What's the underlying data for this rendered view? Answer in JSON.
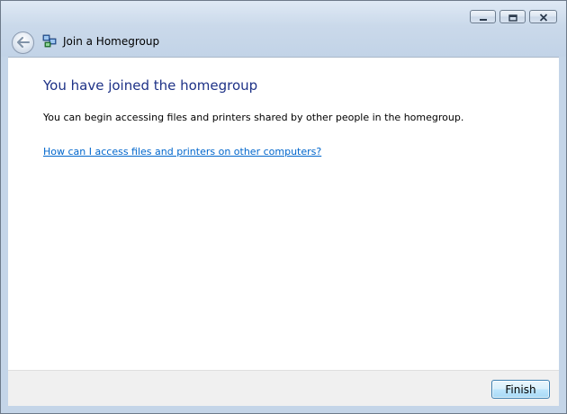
{
  "window": {
    "title": "Join a Homegroup",
    "caption_buttons": [
      "minimize",
      "maximize",
      "close"
    ]
  },
  "icons": {
    "back": "back-arrow-icon",
    "homegroup": "homegroup-icon",
    "minimize": "minimize-icon",
    "maximize": "maximize-icon",
    "close": "close-icon"
  },
  "main": {
    "heading": "You have joined the homegroup",
    "description": "You can begin accessing files and printers shared by other people in the homegroup.",
    "help_link": "How can I access files and printers on other computers?"
  },
  "footer": {
    "finish_label": "Finish"
  },
  "colors": {
    "heading": "#1e3287",
    "link": "#0066cc",
    "frame": "#c4d5e8",
    "footer": "#f0f0f0"
  }
}
